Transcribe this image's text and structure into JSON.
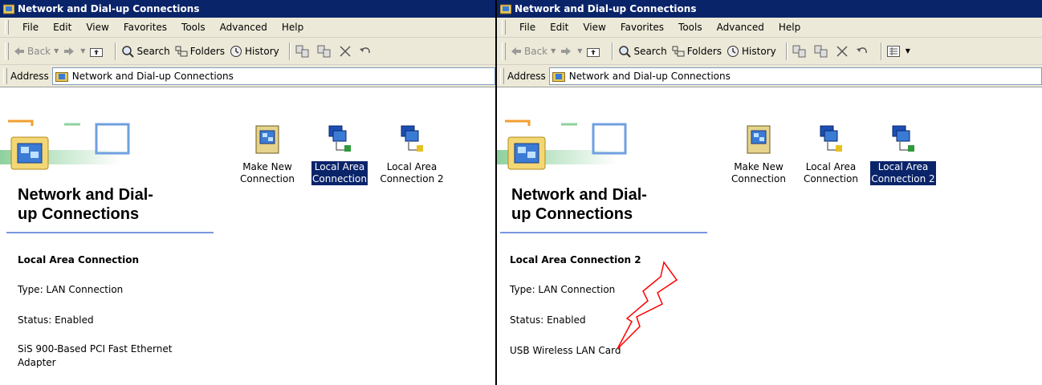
{
  "left": {
    "title": "Network and Dial-up Connections",
    "menu": [
      "File",
      "Edit",
      "View",
      "Favorites",
      "Tools",
      "Advanced",
      "Help"
    ],
    "toolbar": {
      "back": "Back",
      "search": "Search",
      "folders": "Folders",
      "history": "History"
    },
    "address_label": "Address",
    "address_value": "Network and Dial-up Connections",
    "panel_title_1": "Network and Dial-",
    "panel_title_2": "up Connections",
    "icons": [
      {
        "l1": "Make New",
        "l2": "Connection"
      },
      {
        "l1": "Local Area",
        "l2": "Connection"
      },
      {
        "l1": "Local Area",
        "l2": "Connection 2"
      }
    ],
    "details": {
      "name": "Local Area Connection",
      "type": "Type: LAN Connection",
      "status": "Status: Enabled",
      "adapter_1": "SiS 900-Based PCI Fast Ethernet",
      "adapter_2": "Adapter"
    }
  },
  "right": {
    "title": "Network and Dial-up Connections",
    "menu": [
      "File",
      "Edit",
      "View",
      "Favorites",
      "Tools",
      "Advanced",
      "Help"
    ],
    "toolbar": {
      "back": "Back",
      "search": "Search",
      "folders": "Folders",
      "history": "History"
    },
    "address_label": "Address",
    "address_value": "Network and Dial-up Connections",
    "panel_title_1": "Network and Dial-",
    "panel_title_2": "up Connections",
    "icons": [
      {
        "l1": "Make New",
        "l2": "Connection"
      },
      {
        "l1": "Local Area",
        "l2": "Connection"
      },
      {
        "l1": "Local Area",
        "l2": "Connection 2"
      }
    ],
    "details": {
      "name": "Local Area Connection 2",
      "type": "Type: LAN Connection",
      "status": "Status: Enabled",
      "adapter": "USB Wireless LAN Card"
    }
  },
  "colors": {
    "titlebar": "#0a246a",
    "selection": "#0a246a",
    "chrome": "#ece9d8",
    "annotation": "#ff0000"
  }
}
